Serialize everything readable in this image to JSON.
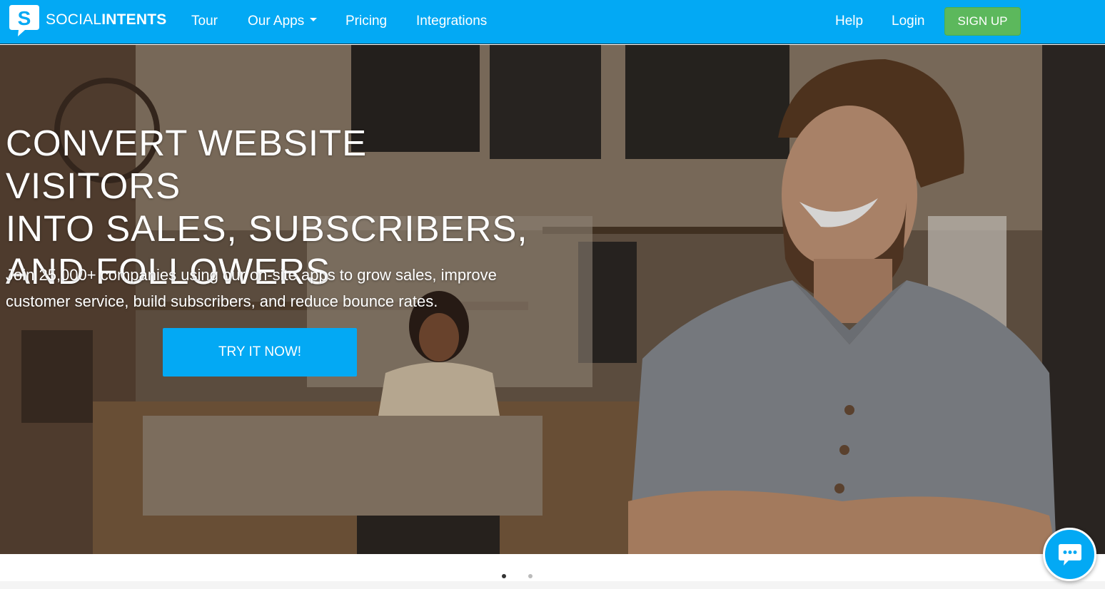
{
  "brand": {
    "name_light": "SOCIAL",
    "name_bold": "INTENTS",
    "logo_icon": "speech-bubble-s-logo"
  },
  "nav": {
    "tour": "Tour",
    "our_apps": "Our Apps",
    "pricing": "Pricing",
    "integrations": "Integrations",
    "help": "Help",
    "login": "Login",
    "signup": "SIGN UP"
  },
  "hero": {
    "title": "CONVERT WEBSITE VISITORS\nINTO SALES, SUBSCRIBERS,\nAND FOLLOWERS",
    "subtitle": "Join 25,000+ companies using our on-site apps to grow sales, improve customer service, build subscribers, and reduce bounce rates.",
    "cta": "TRY IT NOW!",
    "background": "cafe-photo-smiling-man"
  },
  "carousel": {
    "slide_count": 2,
    "active_index": 0
  },
  "chat": {
    "icon": "chat-bubble-icon"
  },
  "colors": {
    "primary": "#03a9f4",
    "signup": "#5cb85c",
    "dot_active": "#333333",
    "dot_inactive": "#bbbbbb"
  }
}
